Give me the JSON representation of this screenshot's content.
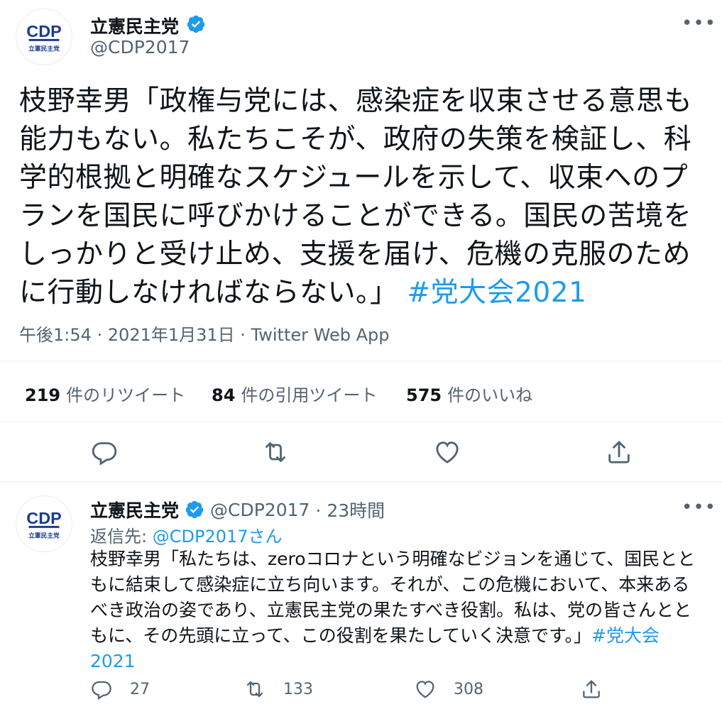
{
  "main_tweet": {
    "display_name": "立憲民主党",
    "handle": "@CDP2017",
    "avatar_text": "立憲民主党",
    "body_text": "枝野幸男「政権与党には、感染症を収束させる意思も能力もない。私たちこそが、政府の失策を検証し、科学的根拠と明確なスケジュールを示して、収束へのプランを国民に呼びかけることができる。国民の苦境をしっかりと受け止め、支援を届け、危機の克服のために行動しなければならない。」",
    "hashtag": "#党大会2021",
    "timestamp": "午後1:54 · 2021年1月31日 · Twitter Web App",
    "retweet_count": "219",
    "retweet_label": "件のリツイート",
    "quote_count": "84",
    "quote_label": "件の引用ツイート",
    "like_count": "575",
    "like_label": "件のいいね"
  },
  "reply_tweet": {
    "display_name": "立憲民主党",
    "handle": "@CDP2017",
    "time_ago": "· 23時間",
    "reply_to_prefix": "返信先:",
    "reply_to_handle": "@CDP2017さん",
    "body_text": "枝野幸男「私たちは、zeroコロナという明確なビジョンを通じて、国民とともに結束して感染症に立ち向います。それが、この危機において、本来あるべき政治の姿であり、立憲民主党の果たすべき役割。私は、党の皆さんとともに、その先頭に立って、この役割を果たしていく決意です。」",
    "hashtag": "#党大会2021",
    "reply_count": "27",
    "retweet_count": "133",
    "like_count": "308"
  },
  "icons": {
    "verified": "verified-badge-icon",
    "more": "more-icon",
    "reply": "reply-icon",
    "retweet": "retweet-icon",
    "like": "like-icon",
    "share": "share-icon"
  },
  "colors": {
    "accent": "#1d9bf0",
    "text": "#0f1419",
    "secondary": "#536471",
    "logo_blue": "#1a3b8f"
  }
}
